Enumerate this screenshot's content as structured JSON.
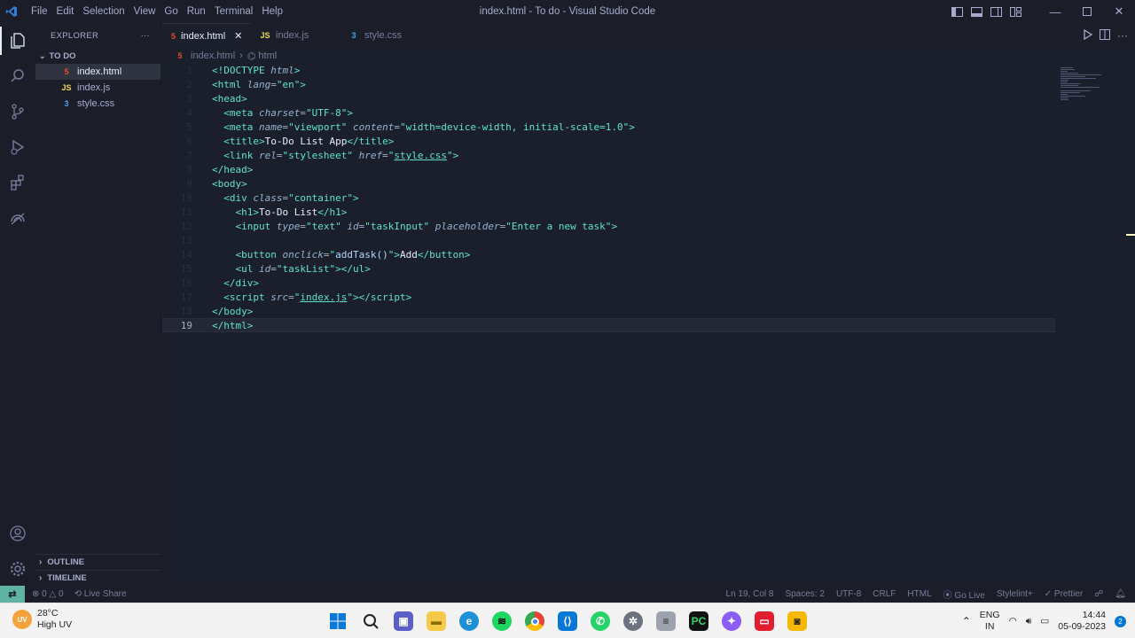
{
  "window": {
    "title": "index.html - To do - Visual Studio Code",
    "menu": [
      "File",
      "Edit",
      "Selection",
      "View",
      "Go",
      "Run",
      "Terminal",
      "Help"
    ]
  },
  "sidebar": {
    "title": "EXPLORER",
    "more": "···",
    "folder": "TO DO",
    "files": [
      {
        "name": "index.html",
        "type_label": "5",
        "icon": "html-file-icon"
      },
      {
        "name": "index.js",
        "type_label": "JS",
        "icon": "js-file-icon"
      },
      {
        "name": "style.css",
        "type_label": "3",
        "icon": "css-file-icon"
      }
    ],
    "outline": "OUTLINE",
    "timeline": "TIMELINE"
  },
  "tabs": [
    {
      "label": "index.html",
      "icon_label": "5",
      "active": true
    },
    {
      "label": "index.js",
      "icon_label": "JS",
      "active": false
    },
    {
      "label": "style.css",
      "icon_label": "3",
      "active": false
    }
  ],
  "breadcrumb": {
    "file": "index.html",
    "node": "html"
  },
  "editor": {
    "current_line": 19,
    "line_numbers": [
      "1",
      "2",
      "3",
      "4",
      "5",
      "6",
      "7",
      "8",
      "9",
      "10",
      "11",
      "12",
      "13",
      "14",
      "15",
      "16",
      "17",
      "18",
      "19"
    ]
  },
  "status": {
    "errors": "0",
    "warnings": "0",
    "live_share": "Live Share",
    "position": "Ln 19, Col 8",
    "spaces": "Spaces: 2",
    "encoding": "UTF-8",
    "eol": "CRLF",
    "language": "HTML",
    "go_live": "Go Live",
    "stylelint": "Stylelint+",
    "prettier": "Prettier"
  },
  "taskbar": {
    "uv_badge": "UV",
    "temperature": "28°C",
    "weather": "High UV",
    "lang_top": "ENG",
    "lang_bottom": "IN",
    "time": "14:44",
    "date": "05-09-2023",
    "notifications": "2"
  },
  "colors": {
    "accent": "#5de4c7",
    "background": "#1b1f2b",
    "remote": "#5fb3a1"
  }
}
